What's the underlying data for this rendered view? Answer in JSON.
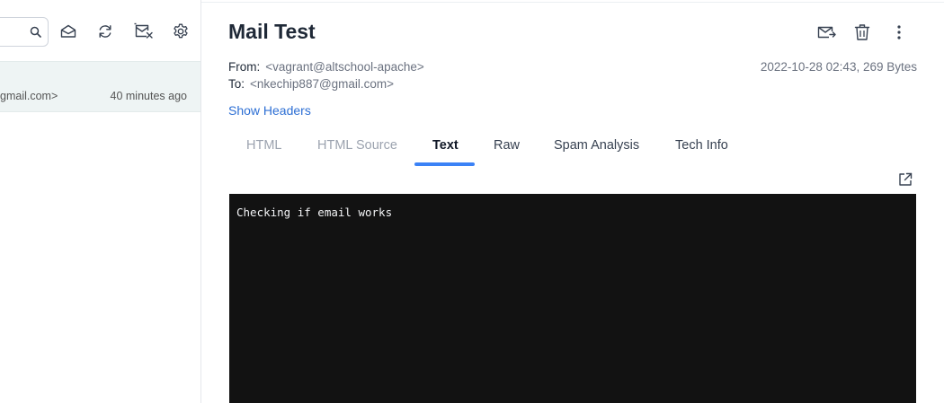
{
  "toolbar": {
    "search_value": "",
    "icons": [
      "search-icon",
      "mark-read-icon",
      "refresh-icon",
      "delete-all-icon",
      "settings-icon"
    ]
  },
  "message_list": [
    {
      "to": "gmail.com>",
      "time": "40 minutes ago"
    }
  ],
  "message": {
    "subject": "Mail Test",
    "from_label": "From:",
    "from_value": "<vagrant@altschool-apache>",
    "to_label": "To:",
    "to_value": "<nkechip887@gmail.com>",
    "meta": "2022-10-28 02:43, 269 Bytes",
    "show_headers": "Show Headers",
    "tabs": [
      {
        "label": "HTML",
        "state": "inactive"
      },
      {
        "label": "HTML Source",
        "state": "inactive"
      },
      {
        "label": "Text",
        "state": "active"
      },
      {
        "label": "Raw",
        "state": "normal"
      },
      {
        "label": "Spam Analysis",
        "state": "normal"
      },
      {
        "label": "Tech Info",
        "state": "normal"
      }
    ],
    "body_text": "Checking if email works",
    "actions": [
      "release-icon",
      "delete-icon",
      "more-icon"
    ]
  },
  "colors": {
    "accent": "#3b82f6",
    "link": "#2d6fd4",
    "selected_row": "#eef4f4",
    "text_view_bg": "#121212"
  }
}
